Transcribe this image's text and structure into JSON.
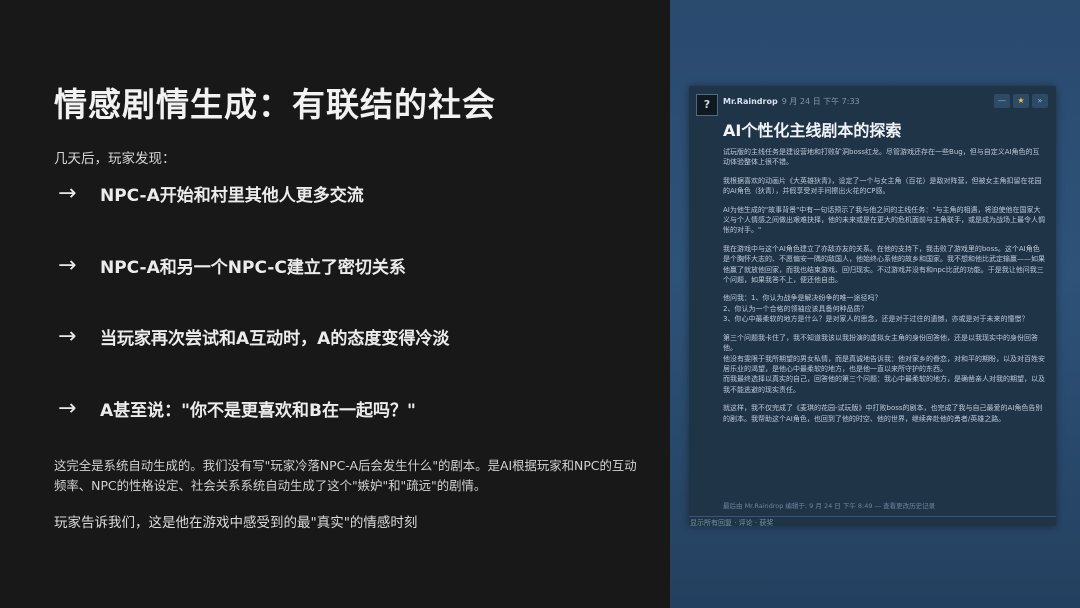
{
  "slide": {
    "title": "情感剧情生成：有联结的社会",
    "intro": "几天后，玩家发现：",
    "bullets": [
      {
        "arrow": "→",
        "text": "NPC-A开始和村里其他人更多交流"
      },
      {
        "arrow": "→",
        "text": "NPC-A和另一个NPC-C建立了密切关系"
      },
      {
        "arrow": "→",
        "text": "当玩家再次尝试和A互动时，A的态度变得冷淡"
      },
      {
        "arrow": "→",
        "text": "A甚至说：\"你不是更喜欢和B在一起吗？\""
      }
    ],
    "paragraph": "这完全是系统自动生成的。我们没有写\"玩家冷落NPC-A后会发生什么\"的剧本。是AI根据玩家和NPC的互动频率、NPC的性格设定、社会关系系统自动生成了这个\"嫉妒\"和\"疏远\"的剧情。",
    "closing": "玩家告诉我们，这是他在游戏中感受到的最\"真实\"的情感时刻"
  },
  "review": {
    "avatar": "?",
    "author": "Mr.Raindrop",
    "date": "9 月 24 日 下午 7:33",
    "tools": [
      "—",
      "★",
      "»"
    ],
    "title": "AI个性化主线剧本的探索",
    "paragraphs": [
      "试玩版的主线任务是建设营地和打败矿洞boss红龙。尽管游戏还存在一些Bug，但与自定义AI角色的互动体验整体上很不错。",
      "我根据喜欢的动画片《大英雄狄青》，设定了一个与女主角（百花）是敌对阵营，但被女主角扣留在花园的AI角色（狄青），并假享受对手间擦出火花的CP感。",
      "AI为他生成的\"故事背景\"中有一句话预示了我与他之间的主线任务：\"与主角的相遇，将迫使他在国家大义与个人情感之间做出艰难抉择，他的未来或是在更大的危机面前与主角联手，或是成为战场上最令人惆怅的对手。\"",
      "我在游戏中与这个AI角色建立了亦敌亦友的关系。在他的支持下，我击败了游戏里的boss。这个AI角色是个胸怀大志的、不愿偏安一隅的敌国人，他始终心系他的故乡和国家。我不想和他比武定输赢——如果他赢了就放他回家，而我也结束游戏、回归现实。不过游戏并没有和npc比武的功能。于是我让他问我三个问题，如果我答不上，便还他自由。",
      "他问我：1、你认为战争是解决纷争的唯一途径吗？\n2、你认为一个合格的领袖应该具备何种品质？\n3、你心中最柔软的地方是什么？是对家人的思念，还是对于过往的遗憾，亦或是对于未来的憧憬？",
      "第三个问题我卡住了，我不知道我该以我扮演的虚拟女主角的身份回答他，还是以我现实中的身份回答他。\n他没有雯限于我所期望的男女私情，而是真诚地告诉我：他对家乡的眷恋，对和平的期盼，以及对百姓安居乐业的渴望，是他心中最柔软的地方，也是他一直以来所守护的东西。\n而我最终选择以真实的自己，回答他的第三个问题：我心中最柔软的地方，是确凿亲人对我的期望，以及我不能逃避的现实责任。",
      "就这样，我不仅完成了《麦琪的花园-试玩版》中打败boss的剧本，也完成了我与自己最爱的AI角色告别的剧本。我帮助这个AI角色，也回到了他的时空、他的世界，继续奔赴他的勇者/英雄之路。"
    ],
    "edited": "最后由 Mr.Raindrop 编辑于: 9 月 24 日 下午 8:49 — 查看更改历史记录",
    "footer": "显示所有回复 · 评论 · 获奖"
  }
}
